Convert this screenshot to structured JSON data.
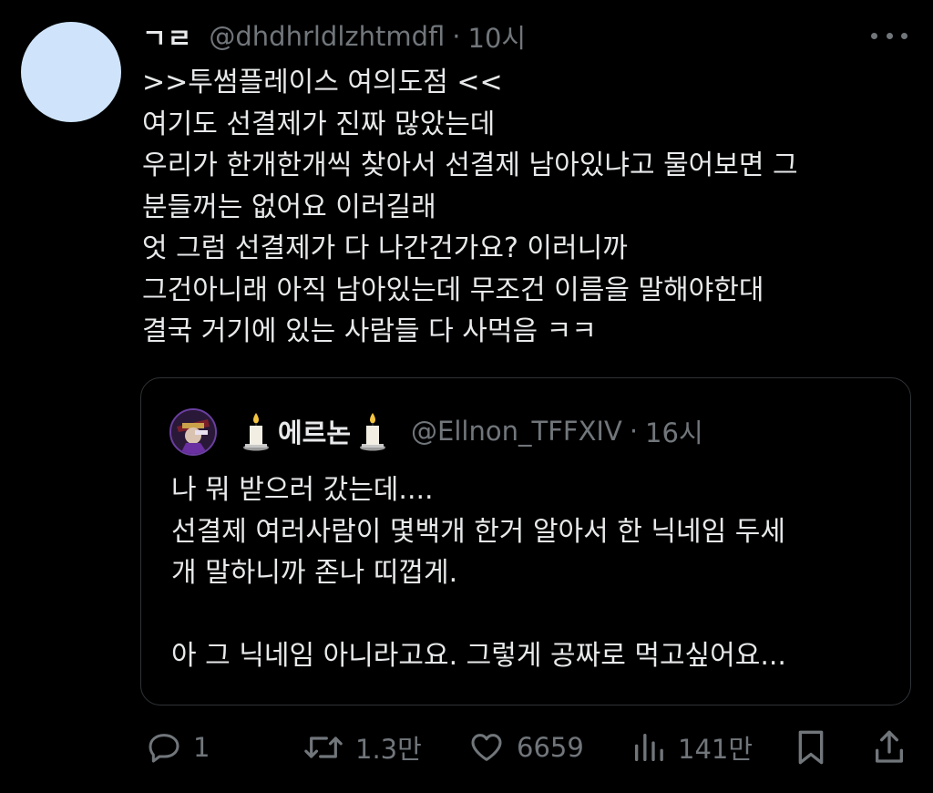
{
  "author": {
    "display_name": "ㄱㄹ",
    "handle": "@dhdhrldlzhtmdfl",
    "separator": "·",
    "time": "10시",
    "avatar_color": "#cfe4fb"
  },
  "body_lines": [
    ">>투썸플레이스 여의도점 <<",
    "여기도 선결제가 진짜 많았는데",
    "우리가 한개한개씩 찾아서 선결제 남아있냐고 물어보면 그",
    "분들꺼는 없어요 이러길래",
    "엇 그럼 선결제가 다 나간건가요? 이러니까",
    "그건아니래 아직 남아있는데 무조건 이름을 말해야한대",
    "결국 거기에 있는 사람들 다 사먹음 ㅋㅋ"
  ],
  "quote": {
    "display_name": "에르논",
    "handle": "@Ellnon_TFFXIV",
    "separator": "·",
    "time": "16시",
    "lines": [
      "나 뭐 받으러 갔는데....",
      "선결제 여러사람이 몇백개 한거 알아서 한 닉네임 두세",
      "개 말하니까 존나 띠껍게.",
      "",
      "아 그 닉네임 아니라고요. 그렇게 공짜로 먹고싶어요..."
    ]
  },
  "actions": {
    "reply": {
      "icon": "reply-icon",
      "count": "1"
    },
    "retweet": {
      "icon": "retweet-icon",
      "count": "1.3만"
    },
    "like": {
      "icon": "heart-icon",
      "count": "6659"
    },
    "views": {
      "icon": "views-icon",
      "count": "141만"
    },
    "bookmark": {
      "icon": "bookmark-icon"
    },
    "share": {
      "icon": "share-icon"
    }
  },
  "colors": {
    "background": "#000000",
    "text_primary": "#e7e9ea",
    "text_secondary": "#71767b",
    "border": "#2f3336"
  }
}
